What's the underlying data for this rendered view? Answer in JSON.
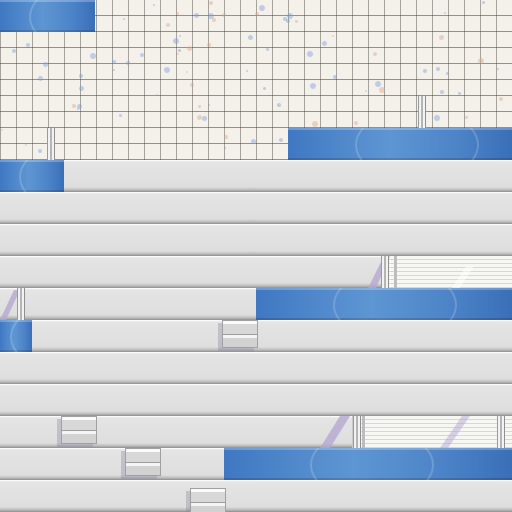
{
  "scene": {
    "floor_tile_color": "#f4f1ea",
    "floor_grout_color": "#46423c",
    "ledge_color": "#e4e4e4",
    "ledge_shadow_color": "#8d8d8d",
    "water_color": "#4d84c8",
    "water_highlight_color": "#5e96d3",
    "speck_colors": [
      "#7ea0d8",
      "#d9a98a"
    ],
    "accent_lilac": "#b6a8cf",
    "icons": [
      "handrail-icon",
      "drain-grate-icon",
      "glass-panel-icon"
    ]
  }
}
